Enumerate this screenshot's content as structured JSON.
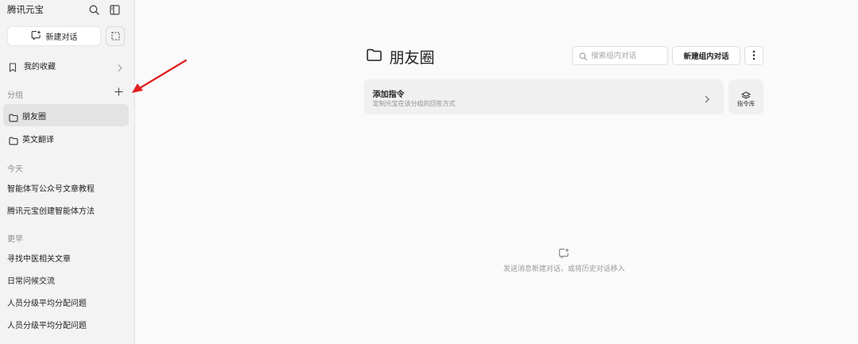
{
  "sidebar": {
    "app_title": "腾讯元宝",
    "icons": {
      "search": "search-icon",
      "panel": "sidebar-toggle-icon",
      "new_chat": "new-chat-icon",
      "select": "select-square-icon",
      "bookmark": "bookmark-icon",
      "chevron": "chevron-right-icon",
      "add": "plus-icon",
      "folder": "folder-icon"
    },
    "new_chat_label": "新建对话",
    "favorites_label": "我的收藏",
    "groups_section_label": "分组",
    "groups": [
      {
        "label": "朋友圈",
        "active": true
      },
      {
        "label": "英文翻译",
        "active": false
      }
    ],
    "today_label": "今天",
    "today_items": [
      "智能体写公众号文章教程",
      "腾讯元宝创建智能体方法"
    ],
    "earlier_label": "更早",
    "earlier_items": [
      "寻找中医相关文章",
      "日常问候交流",
      "人员分级平均分配问题",
      "人员分级平均分配问题"
    ]
  },
  "annotation": {
    "arrow_color": "#e02020"
  },
  "main": {
    "title": "朋友圈",
    "search_placeholder": "搜索组内对话",
    "new_group_chat_label": "新建组内对话",
    "instruction_card": {
      "title": "添加指令",
      "subtitle": "定制元宝在该分组的回答方式"
    },
    "library_label": "指令库",
    "empty_text": "发送消息新建对话，或将历史对话移入"
  }
}
